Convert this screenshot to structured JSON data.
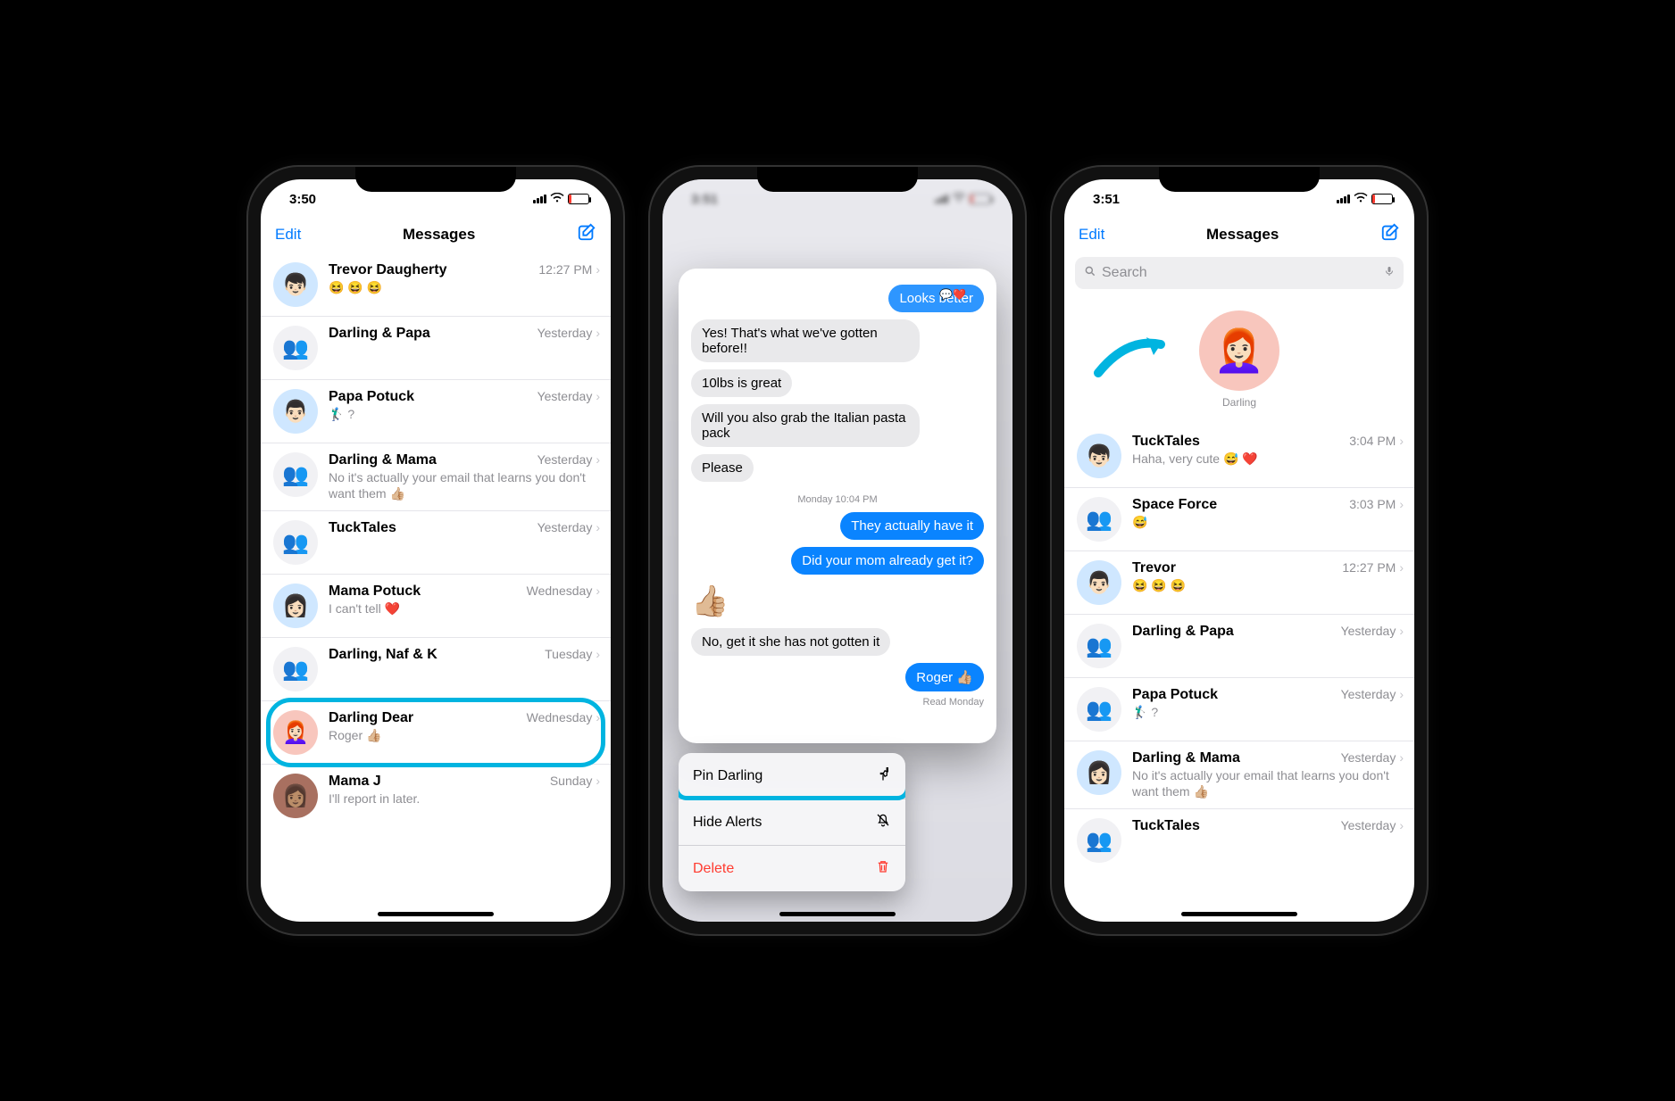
{
  "phone1": {
    "status_time": "3:50",
    "nav": {
      "edit": "Edit",
      "title": "Messages"
    },
    "conversations": [
      {
        "name": "Trevor Daugherty",
        "time": "12:27 PM",
        "preview": "😆 😆 😆"
      },
      {
        "name": "Darling & Papa",
        "time": "Yesterday",
        "preview": ""
      },
      {
        "name": "Papa Potuck",
        "time": "Yesterday",
        "preview": "🏌🏻‍♂️ ?"
      },
      {
        "name": "Darling & Mama",
        "time": "Yesterday",
        "preview": "No it's actually your email that learns you don't want them 👍🏼"
      },
      {
        "name": "TuckTales",
        "time": "Yesterday",
        "preview": ""
      },
      {
        "name": "Mama Potuck",
        "time": "Wednesday",
        "preview": "I can't tell ❤️"
      },
      {
        "name": "Darling, Naf & K",
        "time": "Tuesday",
        "preview": ""
      },
      {
        "name": "Darling Dear",
        "time": "Wednesday",
        "preview": "Roger 👍🏼"
      },
      {
        "name": "Mama J",
        "time": "Sunday",
        "preview": "I'll report in later."
      }
    ],
    "highlight_index": 7
  },
  "phone2": {
    "status_time": "3:51",
    "messages": {
      "out0": "Looks better",
      "in1": "Yes! That's what we've gotten before!!",
      "in2": "10lbs is great",
      "in3": "Will you also grab the Italian pasta pack",
      "in4": "Please",
      "timestamp": "Monday 10:04 PM",
      "out1": "They actually have it",
      "out2": "Did your mom already get it?",
      "in5": "No, get it she has not gotten it",
      "out3": "Roger 👍🏼",
      "read": "Read Monday",
      "thumbs": "👍🏼"
    },
    "menu": {
      "pin": "Pin Darling",
      "hide": "Hide Alerts",
      "delete": "Delete"
    }
  },
  "phone3": {
    "status_time": "3:51",
    "nav": {
      "edit": "Edit",
      "title": "Messages"
    },
    "search_placeholder": "Search",
    "pinned": {
      "name": "Darling"
    },
    "conversations": [
      {
        "name": "TuckTales",
        "time": "3:04 PM",
        "preview": "Haha, very cute 😅 ❤️"
      },
      {
        "name": "Space Force",
        "time": "3:03 PM",
        "preview": "😅"
      },
      {
        "name": "Trevor",
        "time": "12:27 PM",
        "preview": "😆 😆 😆"
      },
      {
        "name": "Darling & Papa",
        "time": "Yesterday",
        "preview": ""
      },
      {
        "name": "Papa Potuck",
        "time": "Yesterday",
        "preview": "🏌🏻‍♂️ ?"
      },
      {
        "name": "Darling & Mama",
        "time": "Yesterday",
        "preview": "No it's actually your email that learns you don't want them 👍🏼"
      },
      {
        "name": "TuckTales",
        "time": "Yesterday",
        "preview": ""
      }
    ]
  }
}
